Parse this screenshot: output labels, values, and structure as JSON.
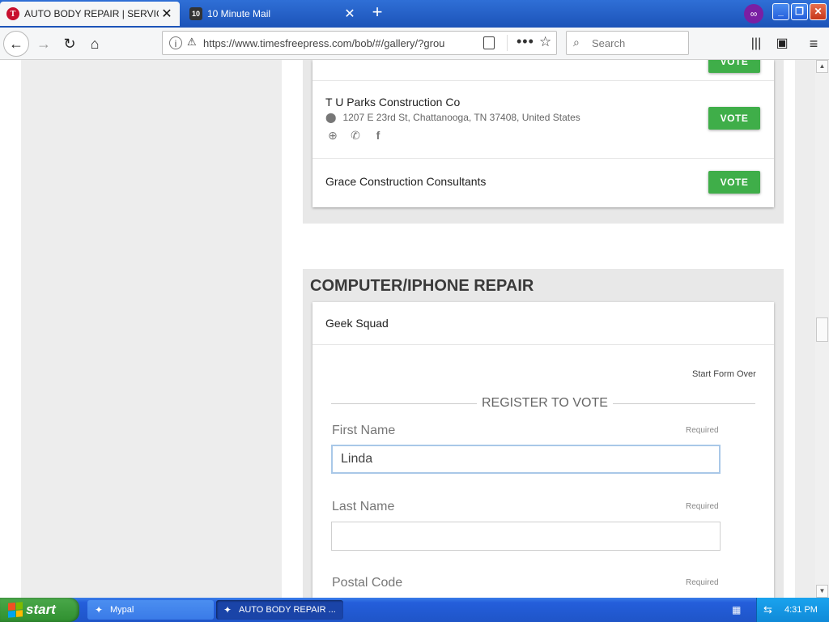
{
  "browser": {
    "tabs": [
      {
        "title": "AUTO BODY REPAIR | SERVICES",
        "favicon": "T",
        "active": true
      },
      {
        "title": "10 Minute Mail",
        "favicon": "10",
        "active": false
      }
    ],
    "url": "https://www.timesfreepress.com/bob/#/gallery/?grou",
    "search_placeholder": "Search"
  },
  "page": {
    "section1": {
      "businesses": [
        {
          "name": "T U Parks Construction Co",
          "address": "1207 E 23rd St, Chattanooga, TN 37408, United States",
          "vote_label": "VOTE"
        },
        {
          "name": "Grace Construction Consultants",
          "vote_label": "VOTE"
        }
      ],
      "partial_vote_label": "VOTE"
    },
    "section2": {
      "category_title": "COMPUTER/IPHONE REPAIR",
      "business_name": "Geek Squad",
      "form": {
        "start_over": "Start Form Over",
        "title": "REGISTER TO VOTE",
        "fields": [
          {
            "label": "First Name",
            "required": "Required",
            "value": "Linda"
          },
          {
            "label": "Last Name",
            "required": "Required",
            "value": ""
          },
          {
            "label": "Postal Code",
            "required": "Required",
            "value": ""
          }
        ]
      }
    }
  },
  "taskbar": {
    "start_label": "start",
    "items": [
      {
        "label": "Mypal"
      },
      {
        "label": "AUTO BODY REPAIR ..."
      }
    ],
    "clock": "4:31 PM"
  },
  "colors": {
    "vote_green": "#3fae49",
    "titlebar_blue": "#1c53b8",
    "taskbar_blue": "#245edb"
  }
}
